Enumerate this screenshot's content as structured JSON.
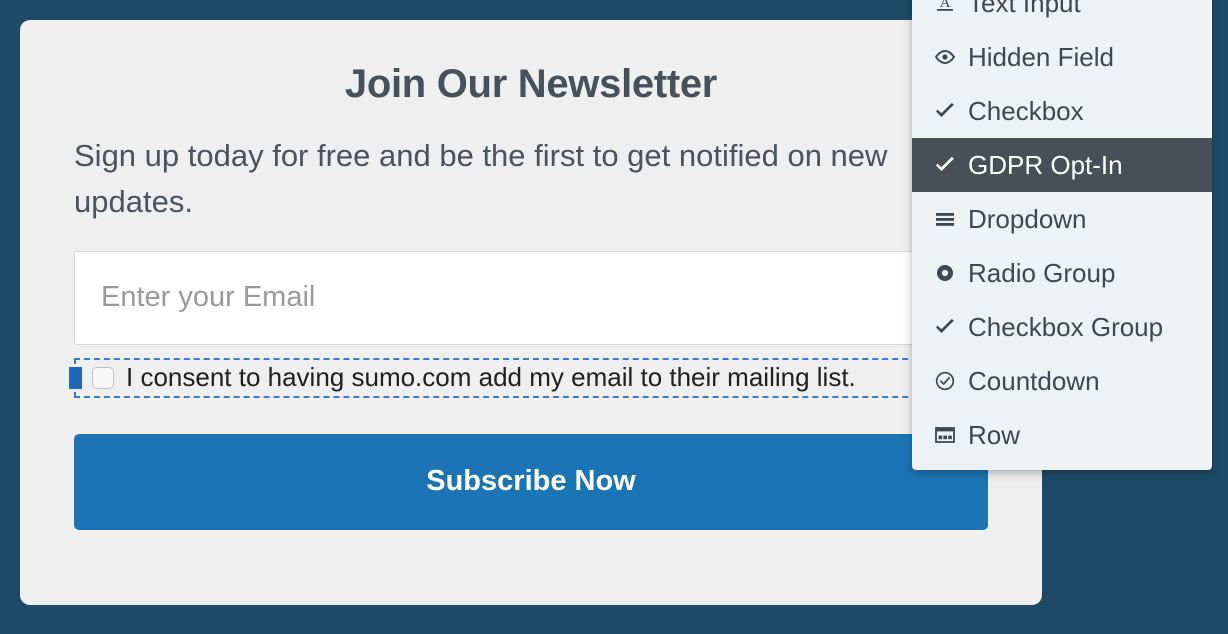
{
  "theme": {
    "background": "#1e4a67",
    "card_background": "#efefef",
    "accent_button": "#1b75b5",
    "selection_outline": "#3a7bc8",
    "selection_handle": "#2266b8",
    "menu_background": "#eef2f5",
    "menu_active_background": "#474f59",
    "heading_color": "#48505a"
  },
  "form": {
    "title": "Join Our Newsletter",
    "subtitle": "Sign up today for free and be the first to get notified on new updates.",
    "email": {
      "placeholder": "Enter your Email",
      "value": ""
    },
    "consent": {
      "label": "I consent to having sumo.com add my email to their mailing list.",
      "checked": false,
      "selected": true
    },
    "submit_label": "Subscribe Now"
  },
  "element_menu": {
    "items": [
      {
        "label": "Text Input",
        "icon": "text-input-icon",
        "active": false
      },
      {
        "label": "Hidden Field",
        "icon": "eye-icon",
        "active": false
      },
      {
        "label": "Checkbox",
        "icon": "check-icon",
        "active": false
      },
      {
        "label": "GDPR Opt-In",
        "icon": "check-icon",
        "active": true
      },
      {
        "label": "Dropdown",
        "icon": "hamburger-icon",
        "active": false
      },
      {
        "label": "Radio Group",
        "icon": "radio-icon",
        "active": false
      },
      {
        "label": "Checkbox Group",
        "icon": "check-icon",
        "active": false
      },
      {
        "label": "Countdown",
        "icon": "clock-check-icon",
        "active": false
      },
      {
        "label": "Row",
        "icon": "row-layout-icon",
        "active": false
      }
    ]
  }
}
